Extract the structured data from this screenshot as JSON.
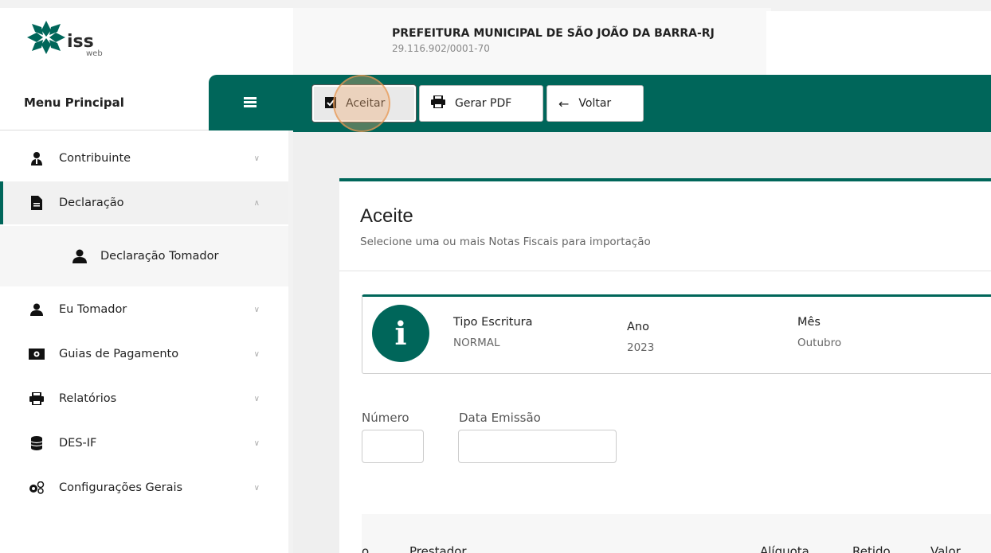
{
  "header": {
    "logo_text": "iss",
    "logo_sub": "web",
    "org_name": "PREFEITURA MUNICIPAL DE SÃO JOÃO DA BARRA-RJ",
    "org_cnpj": "29.116.902/0001-70"
  },
  "sidebar": {
    "title": "Menu Principal",
    "items": [
      {
        "label": "Contribuinte",
        "icon": "user-tie-icon",
        "chevron": "chevron-down"
      },
      {
        "label": "Declaração",
        "icon": "file-icon",
        "chevron": "chevron-up"
      },
      {
        "label": "Eu Tomador",
        "icon": "user-icon",
        "chevron": "chevron-down"
      },
      {
        "label": "Guias de Pagamento",
        "icon": "money-bill-icon",
        "chevron": "chevron-down"
      },
      {
        "label": "Relatórios",
        "icon": "print-icon",
        "chevron": "chevron-down"
      },
      {
        "label": "DES-IF",
        "icon": "database-icon",
        "chevron": "chevron-down"
      },
      {
        "label": "Configurações Gerais",
        "icon": "cogs-icon",
        "chevron": "chevron-down"
      }
    ],
    "sub_item": {
      "label": "Declaração Tomador",
      "icon": "user-icon"
    }
  },
  "toolbar": {
    "aceitar": "Aceitar",
    "gerar_pdf": "Gerar PDF",
    "voltar": "Voltar"
  },
  "card": {
    "title": "Aceite",
    "subtitle": "Selecione uma ou mais Notas Fiscais para importação",
    "info": {
      "tipo_label": "Tipo Escritura",
      "tipo_value": "NORMAL",
      "ano_label": "Ano",
      "ano_value": "2023",
      "mes_label": "Mês",
      "mes_value": "Outubro"
    },
    "fields": {
      "numero_label": "Número",
      "numero_value": "",
      "data_label": "Data Emissão",
      "data_value": ""
    },
    "table_headers": [
      "o",
      "Prestador",
      "Alíquota",
      "Retido",
      "Valor"
    ]
  },
  "colors": {
    "accent": "#00665a"
  }
}
